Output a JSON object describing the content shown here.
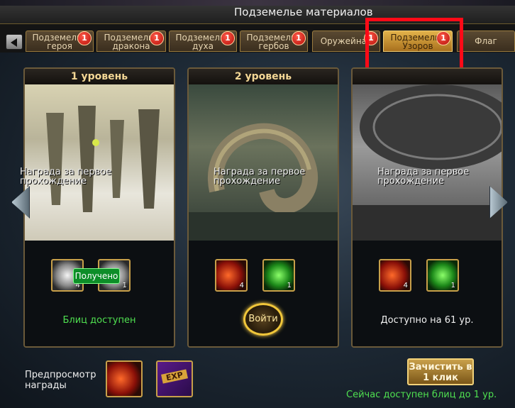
{
  "window": {
    "title": "Подземелье материалов"
  },
  "tabs": [
    {
      "label": "Подземелье героя",
      "badge": "1",
      "active": false
    },
    {
      "label": "Подземелье дракона",
      "badge": "1",
      "active": false
    },
    {
      "label": "Подземелье духа",
      "badge": "1",
      "active": false
    },
    {
      "label": "Подземелье гербов",
      "badge": "1",
      "active": false
    },
    {
      "label": "Оружейная",
      "badge": "1",
      "active": false
    },
    {
      "label": "Подземелье Узоров",
      "badge": "1",
      "active": true
    },
    {
      "label": "Флаг",
      "badge": "",
      "active": false
    }
  ],
  "levels": [
    {
      "title": "1 уровень",
      "reward_label": "Награда за первое прохождение",
      "items": [
        {
          "icon": "grey-emblem-icon",
          "qty": "4"
        },
        {
          "icon": "grey-orb-icon",
          "qty": "1"
        }
      ],
      "received_label": "Получено",
      "status": "Блиц доступен"
    },
    {
      "title": "2 уровень",
      "reward_label": "Награда за первое прохождение",
      "items": [
        {
          "icon": "red-emblem-icon",
          "qty": "4"
        },
        {
          "icon": "green-orb-icon",
          "qty": "1"
        }
      ],
      "enter_label": "Войти"
    },
    {
      "title": "",
      "reward_label": "Награда за первое прохождение",
      "items": [
        {
          "icon": "red-emblem-icon",
          "qty": "4"
        },
        {
          "icon": "green-orb-icon",
          "qty": "1"
        }
      ],
      "status": "Доступно на 61 ур."
    }
  ],
  "footer": {
    "preview_label": "Предпросмотр награды",
    "preview_items": [
      {
        "icon": "red-emblem-icon"
      },
      {
        "icon": "exp-scroll-icon",
        "text": "EXP"
      }
    ],
    "sweep_label": "Зачистить в 1 клик",
    "blitz_note": "Сейчас доступен блиц до 1 ур."
  },
  "colors": {
    "accent_gold": "#f4d795",
    "status_green": "#4fe050",
    "highlight_red": "#ff0a17"
  }
}
